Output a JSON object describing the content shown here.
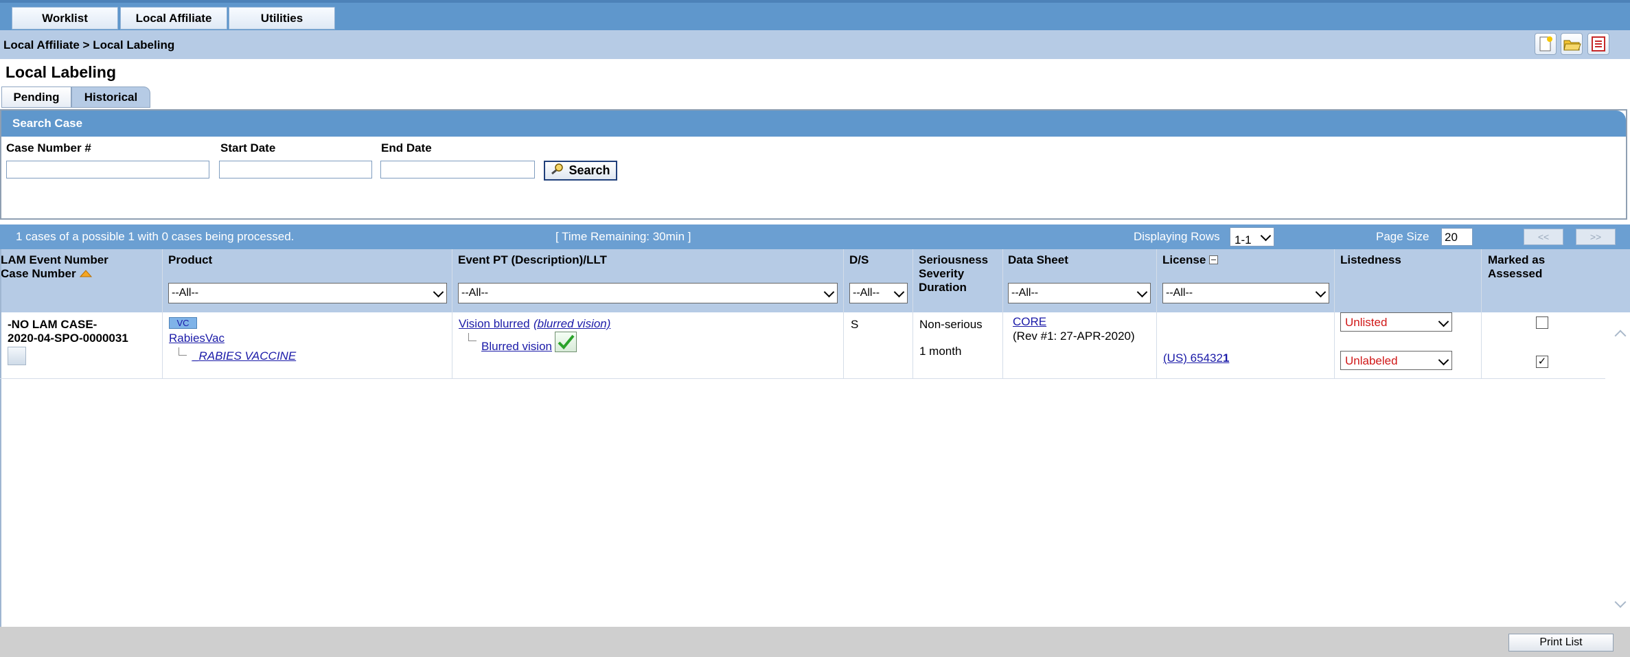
{
  "menu": {
    "items": [
      "Worklist",
      "Local Affiliate",
      "Utilities"
    ]
  },
  "breadcrumb": "Local Affiliate > Local Labeling",
  "toolbar_icons": [
    "new-document-icon",
    "open-folder-icon",
    "list-report-icon"
  ],
  "page_title": "Local Labeling",
  "tabs": [
    "Pending",
    "Historical"
  ],
  "search": {
    "title": "Search Case",
    "case_label": "Case Number #",
    "start_label": "Start Date",
    "end_label": "End Date",
    "case_value": "",
    "start_value": "",
    "end_value": "",
    "button_label": "Search"
  },
  "info": {
    "cases_text": "1 cases of a possible 1 with 0 cases being processed.",
    "time_text": "[ Time Remaining: 30min ]",
    "rows_label": "Displaying Rows",
    "rows_value": "1-1",
    "page_size_label": "Page Size",
    "page_size_value": "20",
    "prev_label": "<<",
    "next_label": ">>"
  },
  "columns": {
    "lam": "LAM Event Number",
    "case": "Case Number",
    "product": "Product",
    "event": "Event PT (Description)/LLT",
    "ds": "D/S",
    "ser1": "Seriousness",
    "ser2": "Severity",
    "ser3": "Duration",
    "datasheet": "Data Sheet",
    "license": "License",
    "listedness": "Listedness",
    "marked1": "Marked as",
    "marked2": "Assessed"
  },
  "filters": {
    "product": "--All--",
    "event": "--All--",
    "ds": "--All--",
    "datasheet": "--All--",
    "license": "--All--"
  },
  "row": {
    "lam": "-NO LAM CASE-",
    "case_number": "2020-04-SPO-0000031",
    "product_badge": "VC",
    "product": "RabiesVac",
    "product_sub": "_RABIES VACCINE",
    "event_pt": "Vision blurred",
    "event_desc": "(blurred vision)",
    "event_llt": "Blurred vision",
    "ds": "S",
    "seriousness": "Non-serious",
    "duration": "1 month",
    "datasheet": "CORE",
    "datasheet_rev": "(Rev #1: 27-APR-2020)",
    "license_prefix": "(US) 65432",
    "license_suffix": "1",
    "listedness": "Unlisted",
    "labeled": "Unlabeled",
    "marked_listed": false,
    "marked_labeled": true,
    "marked_check": "✓"
  },
  "footer": {
    "print_label": "Print List"
  },
  "colors": {
    "header_blue": "#5f97cc",
    "light_blue": "#b6cbe5",
    "link": "#1a1aa8",
    "red": "#d01818"
  }
}
